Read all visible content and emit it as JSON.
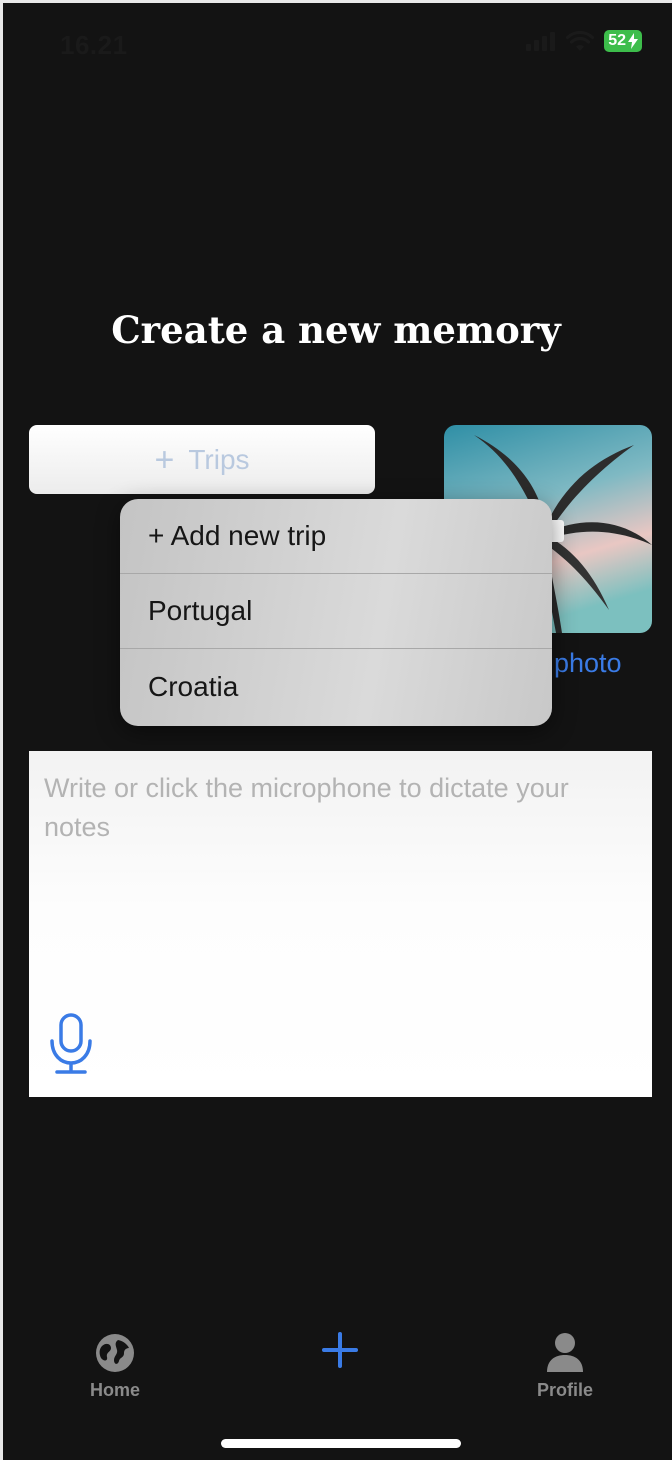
{
  "status": {
    "time": "16.21",
    "battery": "52"
  },
  "page_title": "Create a new memory",
  "trips_button": {
    "label": "Trips",
    "icon": "plus-icon"
  },
  "trip_menu": {
    "items": [
      {
        "label": "+ Add new trip"
      },
      {
        "label": "Portugal"
      },
      {
        "label": "Croatia"
      }
    ]
  },
  "photo": {
    "link_label": "photo",
    "thumb_icon": "palm-tree-photo"
  },
  "notes": {
    "placeholder": "Write or click the microphone to dictate your notes",
    "mic_icon": "microphone-icon"
  },
  "tabbar": {
    "items": [
      {
        "label": "Home",
        "icon": "globe-icon"
      },
      {
        "label": "",
        "icon": "plus-icon"
      },
      {
        "label": "Profile",
        "icon": "person-icon"
      }
    ]
  },
  "colors": {
    "background": "#131313",
    "accent": "#3a7be6",
    "battery": "#3dbd4b"
  }
}
